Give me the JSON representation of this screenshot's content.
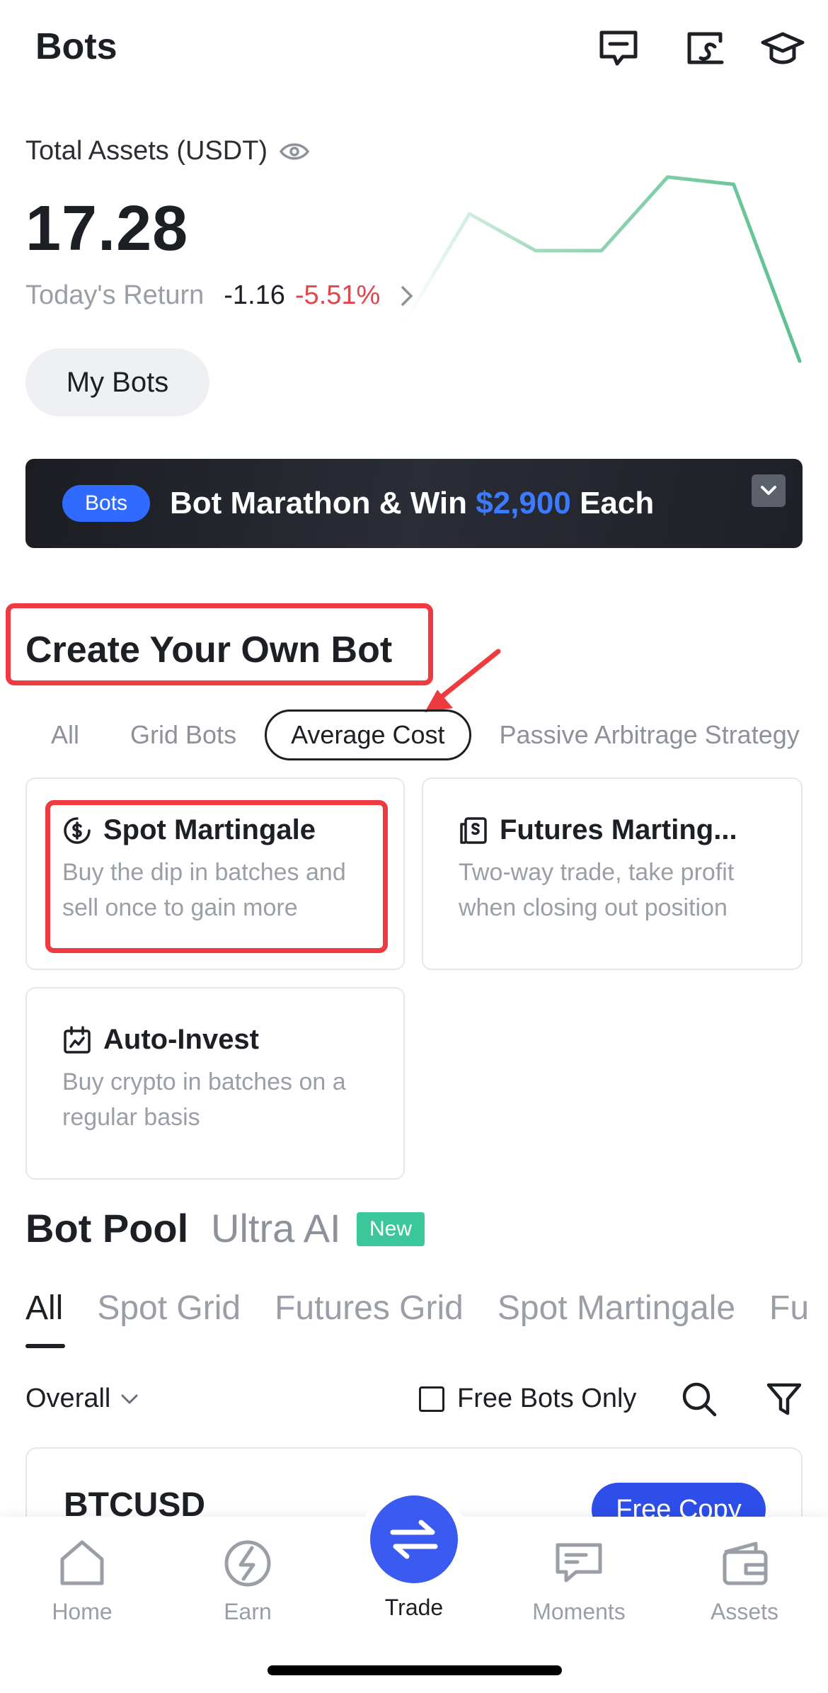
{
  "header": {
    "title": "Bots",
    "icons": [
      "message-icon",
      "sign-icon",
      "graduation-cap-icon"
    ]
  },
  "assets": {
    "label": "Total Assets (USDT)",
    "value": "17.28",
    "return_label": "Today's Return",
    "return_abs": "-1.16",
    "return_pct": "-5.51%",
    "sparkline_trend": [
      2,
      5,
      4,
      4,
      6,
      5.8,
      1
    ]
  },
  "my_bots_label": "My Bots",
  "banner": {
    "tag": "Bots",
    "text_before": "Bot Marathon & Win ",
    "highlight": "$2,900",
    "text_after": " Each",
    "highlight_color": "#3c7bff"
  },
  "create": {
    "title": "Create Your Own Bot",
    "chips": [
      "All",
      "Grid Bots",
      "Average Cost",
      "Passive Arbitrage Strategy"
    ],
    "active_chip": "Average Cost",
    "cards": [
      {
        "icon": "dollar-circle-icon",
        "title": "Spot Martingale",
        "desc": "Buy the dip in batches and sell once to gain more"
      },
      {
        "icon": "futures-doc-icon",
        "title": "Futures Marting...",
        "desc": "Two-way trade, take profit when closing out position"
      },
      {
        "icon": "calendar-icon",
        "title": "Auto-Invest",
        "desc": "Buy crypto in batches on a regular basis"
      }
    ]
  },
  "pool": {
    "title": "Bot Pool",
    "ultra": "Ultra AI",
    "new_badge": "New",
    "tabs": [
      "All",
      "Spot Grid",
      "Futures Grid",
      "Spot Martingale",
      "Fu"
    ],
    "sort": "Overall",
    "free_only": "Free Bots Only",
    "first_card": {
      "name": "BTCUSD",
      "action": "Free Copy"
    }
  },
  "nav": {
    "items": [
      "Home",
      "Earn",
      "Trade",
      "Moments",
      "Assets"
    ],
    "active": "Trade"
  },
  "colors": {
    "accent": "#3b5bf0",
    "negative": "#e0474a",
    "positive_line": "#5cc08e",
    "highlight_box": "#ee3b3f",
    "new_badge": "#3cc79a"
  }
}
